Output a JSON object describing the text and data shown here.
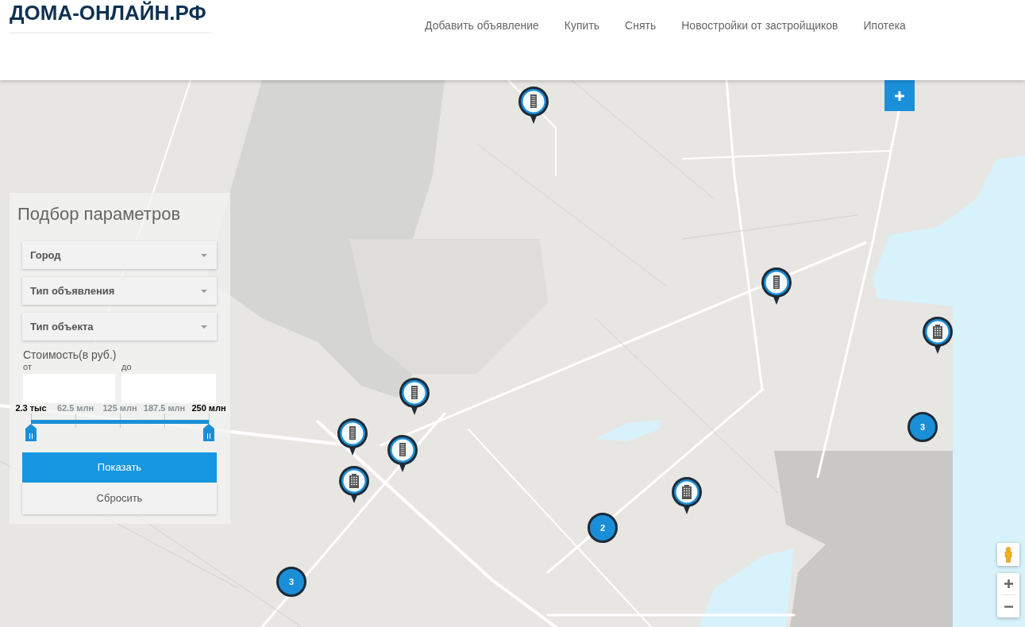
{
  "header": {
    "logo": "ДОМА-ОНЛАЙН.РФ",
    "nav": [
      {
        "label": "Добавить объявление"
      },
      {
        "label": "Купить"
      },
      {
        "label": "Снять"
      },
      {
        "label": "Новостройки от застройщиков"
      },
      {
        "label": "Ипотека"
      }
    ]
  },
  "filter": {
    "title": "Подбор параметров",
    "dropdowns": [
      {
        "label": "Город"
      },
      {
        "label": "Тип объявления"
      },
      {
        "label": "Тип объекта"
      }
    ],
    "price": {
      "label": "Стоимость(в руб.)",
      "from_label": "от",
      "to_label": "до",
      "scale": [
        {
          "label": "2.3 тыс",
          "selected": true
        },
        {
          "label": "62.5 млн",
          "selected": false
        },
        {
          "label": "125 млн",
          "selected": false
        },
        {
          "label": "187.5 млн",
          "selected": false
        },
        {
          "label": "250 млн",
          "selected": true
        }
      ],
      "handles": [
        {
          "level": 0
        },
        {
          "level": 1
        }
      ]
    },
    "buttons": [
      {
        "label": "Показать",
        "kind": "primary"
      },
      {
        "label": "Сбросить",
        "kind": "secondary"
      }
    ]
  },
  "map": {
    "markers": [
      {
        "kind": "tower"
      },
      {
        "kind": "tower"
      },
      {
        "kind": "block"
      },
      {
        "kind": "tower"
      },
      {
        "kind": "tower"
      },
      {
        "kind": "tower"
      },
      {
        "kind": "block"
      },
      {
        "kind": "block"
      }
    ],
    "clusters": [
      {
        "count": "3"
      },
      {
        "count": "2"
      },
      {
        "count": "3"
      }
    ]
  }
}
